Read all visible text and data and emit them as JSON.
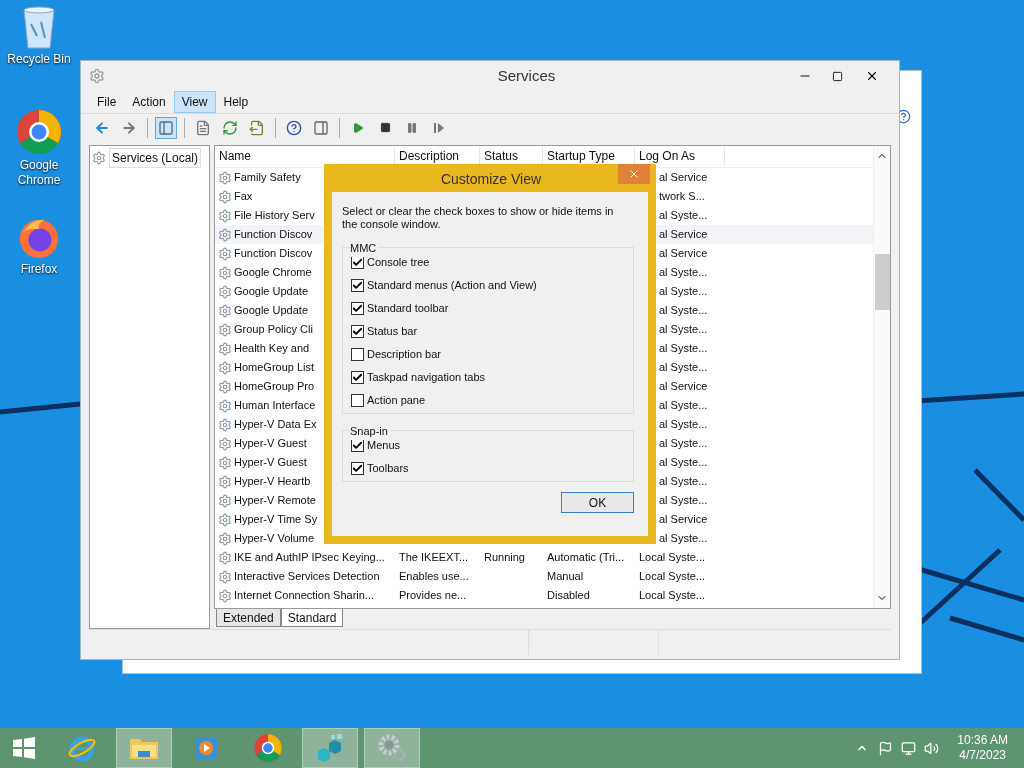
{
  "desktop_icons": [
    {
      "label": "Recycle Bin",
      "kind": "recycle"
    },
    {
      "label": "Google Chrome",
      "kind": "chrome"
    },
    {
      "label": "Firefox",
      "kind": "firefox"
    }
  ],
  "window": {
    "title": "Services",
    "menu": [
      {
        "label": "File",
        "selected": false
      },
      {
        "label": "Action",
        "selected": false
      },
      {
        "label": "View",
        "selected": true
      },
      {
        "label": "Help",
        "selected": false
      }
    ],
    "toolbar_groups": [
      [
        {
          "kind": "back",
          "selected": false
        },
        {
          "kind": "forward",
          "selected": false
        }
      ],
      [
        {
          "kind": "tree",
          "selected": true
        }
      ],
      [
        {
          "kind": "properties",
          "selected": false
        },
        {
          "kind": "refresh",
          "selected": false
        },
        {
          "kind": "export",
          "selected": false
        }
      ],
      [
        {
          "kind": "help",
          "selected": false
        },
        {
          "kind": "pane",
          "selected": false
        }
      ],
      [
        {
          "kind": "play",
          "selected": false
        },
        {
          "kind": "stop",
          "selected": false
        },
        {
          "kind": "pause",
          "selected": false
        },
        {
          "kind": "resume",
          "selected": false
        }
      ]
    ],
    "tree": [
      {
        "label": "Services (Local)"
      }
    ],
    "columns": [
      "Name",
      "Description",
      "Status",
      "Startup Type",
      "Log On As"
    ],
    "rows": [
      {
        "kind": "covered",
        "name": "Family Safety",
        "log_on": "al Service",
        "hovered": false
      },
      {
        "kind": "covered",
        "name": "Fax",
        "log_on": "twork S...",
        "hovered": false
      },
      {
        "kind": "covered",
        "name": "File History Serv",
        "log_on": "al Syste...",
        "hovered": false
      },
      {
        "kind": "covered",
        "name": "Function Discov",
        "log_on": "al Service",
        "hovered": true
      },
      {
        "kind": "covered",
        "name": "Function Discov",
        "log_on": "al Service",
        "hovered": false
      },
      {
        "kind": "covered",
        "name": "Google Chrome",
        "log_on": "al Syste...",
        "hovered": false
      },
      {
        "kind": "covered",
        "name": "Google Update",
        "log_on": "al Syste...",
        "hovered": false
      },
      {
        "kind": "covered",
        "name": "Google Update",
        "log_on": "al Syste...",
        "hovered": false
      },
      {
        "kind": "covered",
        "name": "Group Policy Cli",
        "log_on": "al Syste...",
        "hovered": false
      },
      {
        "kind": "covered",
        "name": "Health Key and",
        "log_on": "al Syste...",
        "hovered": false
      },
      {
        "kind": "covered",
        "name": "HomeGroup List",
        "log_on": "al Syste...",
        "hovered": false
      },
      {
        "kind": "covered",
        "name": "HomeGroup Pro",
        "log_on": "al Service",
        "hovered": false
      },
      {
        "kind": "covered",
        "name": "Human Interface",
        "log_on": "al Syste...",
        "hovered": false
      },
      {
        "kind": "covered",
        "name": "Hyper-V Data Ex",
        "log_on": "al Syste...",
        "hovered": false
      },
      {
        "kind": "covered",
        "name": "Hyper-V Guest",
        "log_on": "al Syste...",
        "hovered": false
      },
      {
        "kind": "covered",
        "name": "Hyper-V Guest",
        "log_on": "al Syste...",
        "hovered": false
      },
      {
        "kind": "covered",
        "name": "Hyper-V Heartb",
        "log_on": "al Syste...",
        "hovered": false
      },
      {
        "kind": "covered",
        "name": "Hyper-V Remote",
        "log_on": "al Syste...",
        "hovered": false
      },
      {
        "kind": "covered",
        "name": "Hyper-V Time Sy",
        "log_on": "al Service",
        "hovered": false
      },
      {
        "kind": "covered",
        "name": "Hyper-V Volume",
        "log_on": "al Syste...",
        "hovered": false
      },
      {
        "kind": "full",
        "name": "IKE and AuthIP IPsec Keying...",
        "description": "The IKEEXT...",
        "status": "Running",
        "startup_type": "Automatic (Tri...",
        "log_on": "Local Syste...",
        "hovered": false
      },
      {
        "kind": "full",
        "name": "Interactive Services Detection",
        "description": "Enables use...",
        "status": "",
        "startup_type": "Manual",
        "log_on": "Local Syste...",
        "hovered": false
      },
      {
        "kind": "full",
        "name": "Internet Connection Sharin...",
        "description": "Provides ne...",
        "status": "",
        "startup_type": "Disabled",
        "log_on": "Local Syste...",
        "hovered": false
      }
    ],
    "tabs": [
      {
        "label": "Extended",
        "selected": false
      },
      {
        "label": "Standard",
        "selected": true
      }
    ]
  },
  "dialog": {
    "title": "Customize View",
    "intro": "Select or clear the check boxes to show or hide items in the console window.",
    "groups": [
      {
        "label": "MMC",
        "options": [
          {
            "label": "Console tree",
            "checked": true
          },
          {
            "label": "Standard menus (Action and View)",
            "checked": true
          },
          {
            "label": "Standard toolbar",
            "checked": true
          },
          {
            "label": "Status bar",
            "checked": true
          },
          {
            "label": "Description bar",
            "checked": false
          },
          {
            "label": "Taskpad navigation tabs",
            "checked": true
          },
          {
            "label": "Action pane",
            "checked": false
          }
        ]
      },
      {
        "label": "Snap-in",
        "options": [
          {
            "label": "Menus",
            "checked": true
          },
          {
            "label": "Toolbars",
            "checked": true
          }
        ]
      }
    ],
    "ok": "OK"
  },
  "taskbar": {
    "apps": [
      {
        "kind": "start",
        "active": false
      },
      {
        "kind": "ie",
        "active": false
      },
      {
        "kind": "explorer",
        "active": true
      },
      {
        "kind": "media",
        "active": false
      },
      {
        "kind": "chrome",
        "active": false
      },
      {
        "kind": "cubes",
        "active": true
      },
      {
        "kind": "gears",
        "active": true
      }
    ],
    "time": "10:36 AM",
    "date": "4/7/2023"
  }
}
